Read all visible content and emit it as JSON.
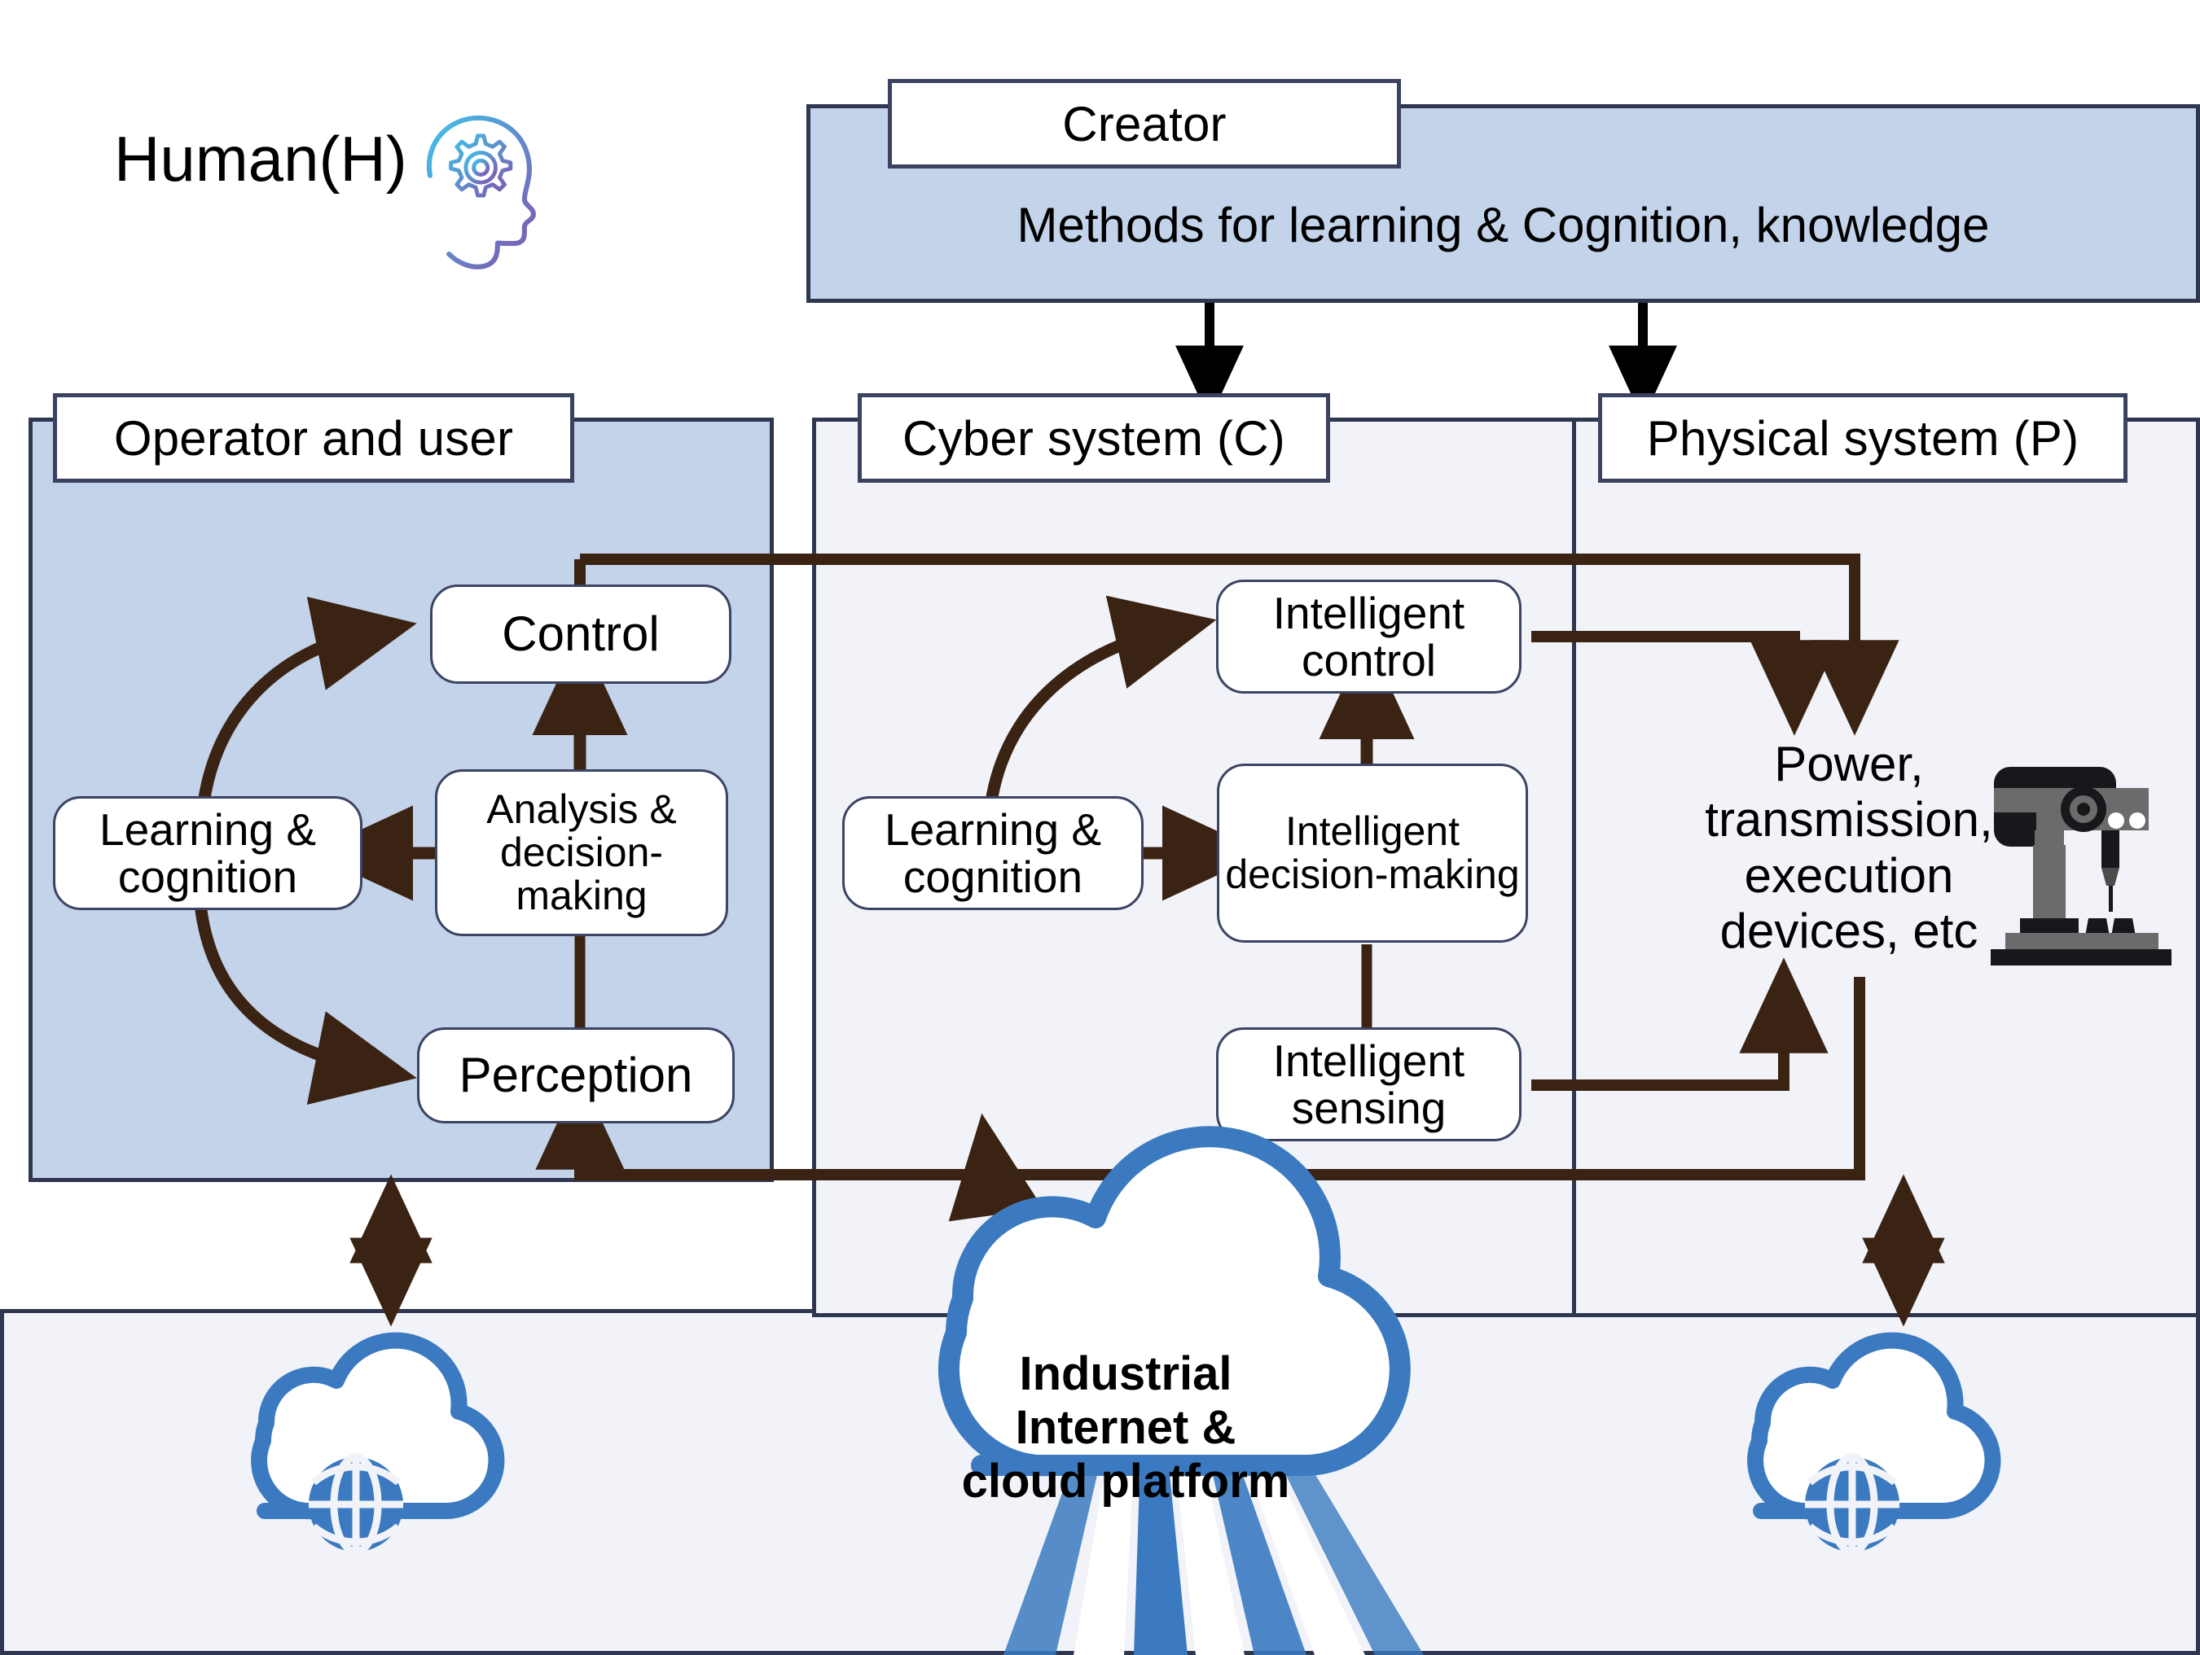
{
  "meta": {
    "accent_blue_panel": "#c3d3e9",
    "accent_grey_panel": "#f1f3f8",
    "panel_border": "#2e3650",
    "arrow_brown": "#3b2314",
    "cloud_blue": "#3b7ac0",
    "robot_grey": "#6b6b6b",
    "robot_dark": "#17171c"
  },
  "human": {
    "label": "Human(H)",
    "icon": "head-gear-icon"
  },
  "creator": {
    "tab_label": "Creator",
    "banner_text": "Methods for learning & Cognition, knowledge"
  },
  "panels": {
    "operator": {
      "title": "Operator and user",
      "nodes": [
        {
          "id": "control",
          "label": "Control"
        },
        {
          "id": "learning_cognition",
          "label": "Learning &\ncognition"
        },
        {
          "id": "analysis_decision",
          "label": "Analysis &\ndecision-making"
        },
        {
          "id": "perception",
          "label": "Perception"
        }
      ]
    },
    "cyber": {
      "title": "Cyber system (C)",
      "nodes": [
        {
          "id": "intelligent_control",
          "label": "Intelligent\ncontrol"
        },
        {
          "id": "learning_cognition_c",
          "label": "Learning &\ncognition"
        },
        {
          "id": "intelligent_decision",
          "label": "Intelligent\ndecision-making"
        },
        {
          "id": "intelligent_sensing",
          "label": "Intelligent\nsensing"
        }
      ]
    },
    "physical": {
      "title": "Physical system (P)",
      "body_text": "Power,\ntransmission,\nexecution\ndevices, etc",
      "icon": "industrial-robot-icon"
    }
  },
  "bottom": {
    "cloud_platform_label": "Industrial Internet &\ncloud platform",
    "left_cloud_icon": "cloud-globe-icon",
    "right_cloud_icon": "cloud-globe-icon"
  }
}
